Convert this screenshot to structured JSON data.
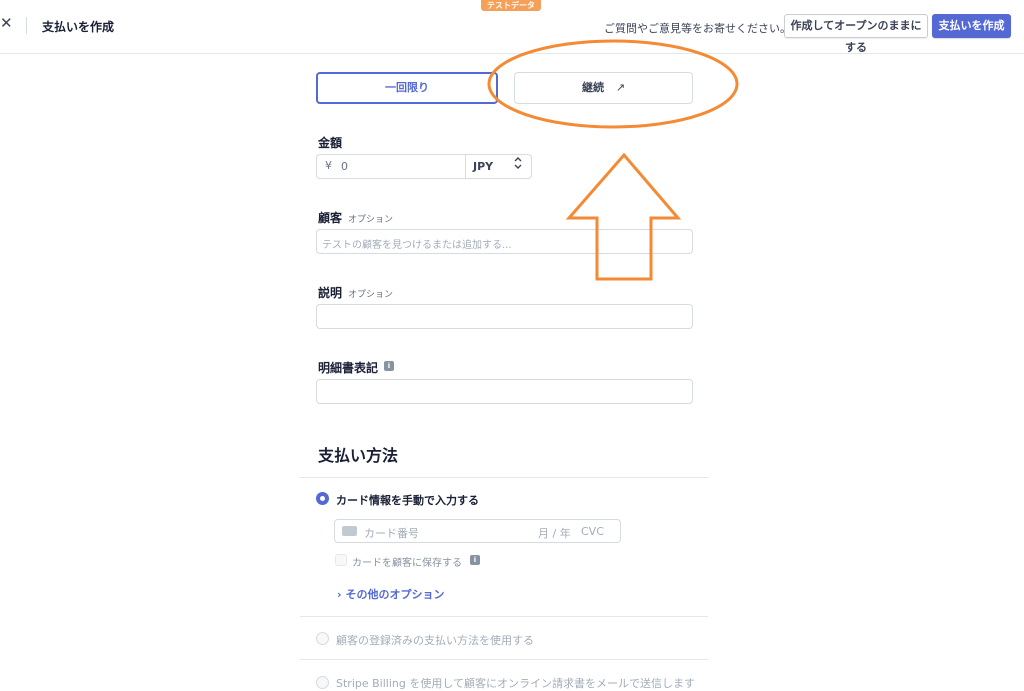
{
  "header": {
    "close_icon": "close-icon",
    "title": "支払いを作成",
    "test_badge": "テストデータ",
    "feedback": "ご質問やご意見等をお寄せください。",
    "create_and_open": "作成してオープンのままにする",
    "create_payment": "支払いを作成"
  },
  "tabs": {
    "one_time": "一回限り",
    "recurring": "継続",
    "recurring_icon": "external-link-icon"
  },
  "amount": {
    "label": "金額",
    "symbol": "¥",
    "value": "0",
    "currency": "JPY"
  },
  "customer": {
    "label": "顧客",
    "optional": "オプション",
    "placeholder": "テストの顧客を見つけるまたは追加する..."
  },
  "description": {
    "label": "説明",
    "optional": "オプション",
    "value": ""
  },
  "statement": {
    "label": "明細書表記",
    "info_icon": "info-icon",
    "value": ""
  },
  "payment_method": {
    "heading": "支払い方法",
    "manual_card": "カード情報を手動で入力する",
    "card_number_placeholder": "カード番号",
    "expiry_placeholder": "月 / 年",
    "cvc_placeholder": "CVC",
    "save_card": "カードを顧客に保存する",
    "more_options": "その他のオプション",
    "use_saved": "顧客の登録済みの支払い方法を使用する",
    "send_invoice": "Stripe Billing を使用して顧客にオンライン請求書をメールで送信します"
  },
  "colors": {
    "accent": "#5469d4",
    "annotation": "#f58a34",
    "test_badge": "#f5a058"
  }
}
